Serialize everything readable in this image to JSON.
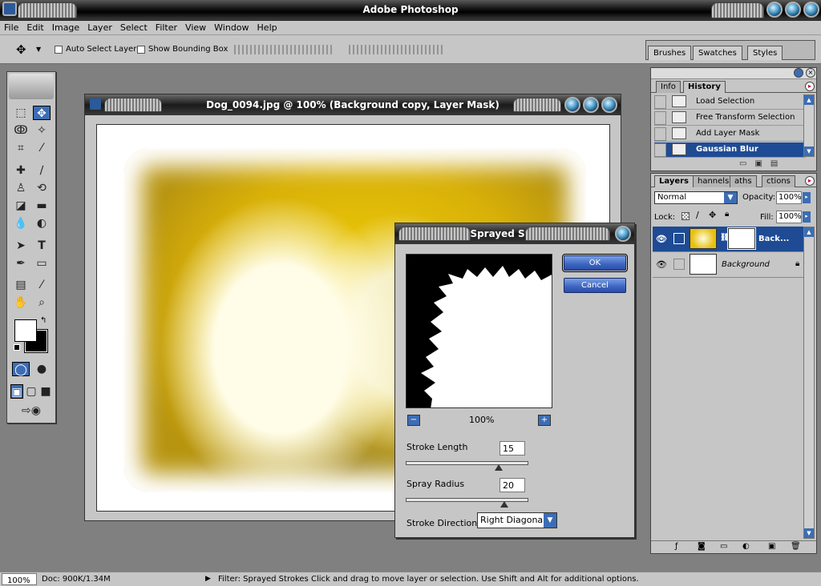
{
  "app": {
    "title": "Adobe Photoshop"
  },
  "menu": [
    "File",
    "Edit",
    "Image",
    "Layer",
    "Select",
    "Filter",
    "View",
    "Window",
    "Help"
  ],
  "options": {
    "auto_select": "Auto Select Layer",
    "show_bbox": "Show Bounding Box"
  },
  "palette_well": {
    "tabs": [
      "Brushes",
      "Swatches",
      "Styles"
    ]
  },
  "document": {
    "title": "Dog_0094.jpg @ 100% (Background copy, Layer Mask)"
  },
  "dialog": {
    "title": "Sprayed Strokes",
    "ok": "OK",
    "cancel": "Cancel",
    "zoom": "100%",
    "stroke_length_label": "Stroke Length",
    "stroke_length_value": "15",
    "stroke_length_level": 15,
    "spray_radius_label": "Spray Radius",
    "spray_radius_value": "20",
    "spray_radius_level": 20,
    "direction_label": "Stroke Direction:",
    "direction_value": "Right Diagonal"
  },
  "history_palette": {
    "tabs": [
      "Info",
      "History"
    ],
    "items": [
      {
        "label": "Load Selection"
      },
      {
        "label": "Free Transform Selection"
      },
      {
        "label": "Add Layer Mask"
      },
      {
        "label": "Gaussian Blur"
      }
    ]
  },
  "layers_palette": {
    "tabs": [
      "Layers",
      "Channels",
      "Paths",
      "Actions"
    ],
    "tab_labels": [
      "Layers",
      "hannels",
      "aths",
      "ctions"
    ],
    "blend_mode": "Normal",
    "opacity_label": "Opacity:",
    "opacity": "100%",
    "lock_label": "Lock:",
    "fill_label": "Fill:",
    "fill": "100%",
    "layers": [
      {
        "name": "Back..."
      },
      {
        "name": "Background"
      }
    ]
  },
  "status": {
    "zoom": "100%",
    "doc": "Doc: 900K/1.34M",
    "filter": "Filter: Sprayed Strokes",
    "hint": "Click and drag to move layer or selection.  Use Shift and Alt for additional options."
  },
  "icons": {
    "toolbox": [
      "marquee",
      "move",
      "lasso",
      "magic-wand",
      "crop",
      "slice",
      "healing",
      "brush",
      "stamp",
      "history-brush",
      "eraser",
      "gradient",
      "blur",
      "dodge",
      "path-select",
      "type",
      "pen",
      "shape",
      "notes",
      "eyedropper",
      "hand",
      "zoom"
    ]
  },
  "colors": {
    "selection": "#1e4b94",
    "button": "#3c64c0",
    "chrome": "#c6c6c6"
  }
}
